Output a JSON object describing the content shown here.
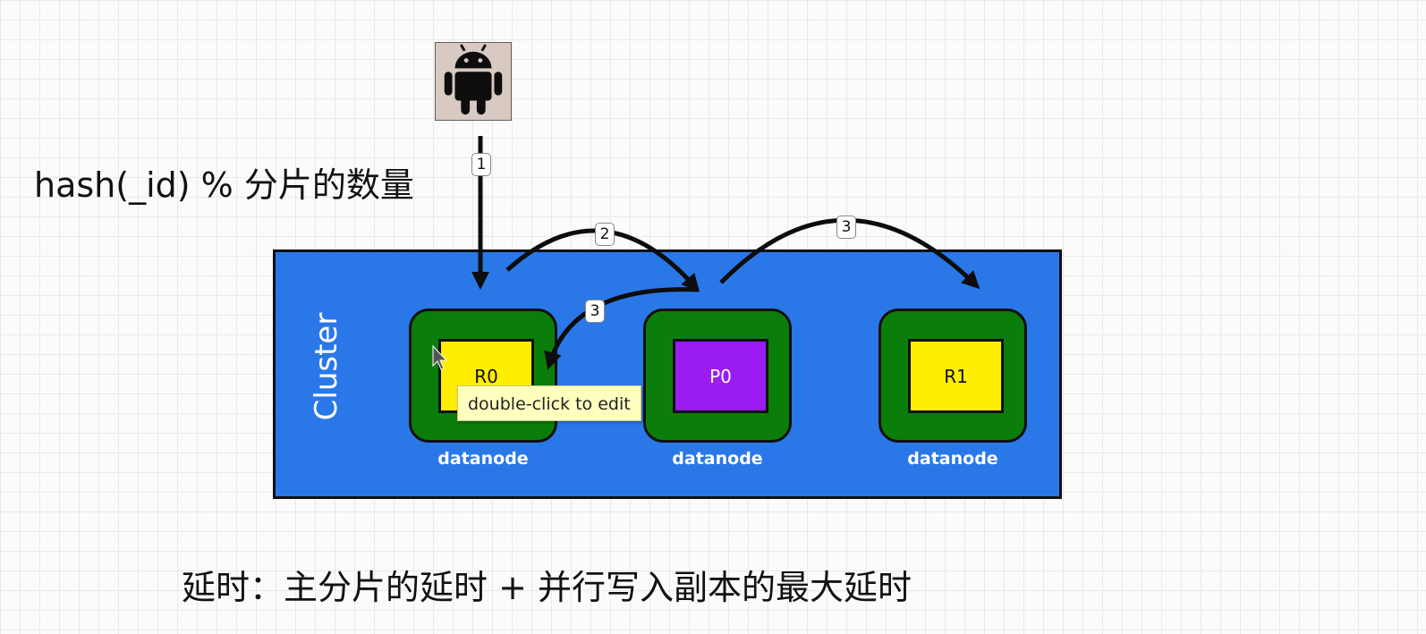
{
  "client": {
    "icon": "android-icon"
  },
  "formula": "hash(_id) % 分片的数量",
  "cluster": {
    "label": "Cluster",
    "color": "#2a78e8"
  },
  "nodes": [
    {
      "label": "datanode",
      "shard": "R0",
      "shard_role": "replica"
    },
    {
      "label": "datanode",
      "shard": "P0",
      "shard_role": "primary"
    },
    {
      "label": "datanode",
      "shard": "R1",
      "shard_role": "replica"
    }
  ],
  "steps": {
    "route": "1",
    "forward": "2",
    "replicate_right": "3",
    "replicate_left": "3"
  },
  "tooltip": "double-click to edit",
  "caption": "延时：主分片的延时 + 并行写入副本的最大延时",
  "colors": {
    "node": "#0b7d0b",
    "replica": "#ffee00",
    "primary": "#9a1cf0"
  }
}
